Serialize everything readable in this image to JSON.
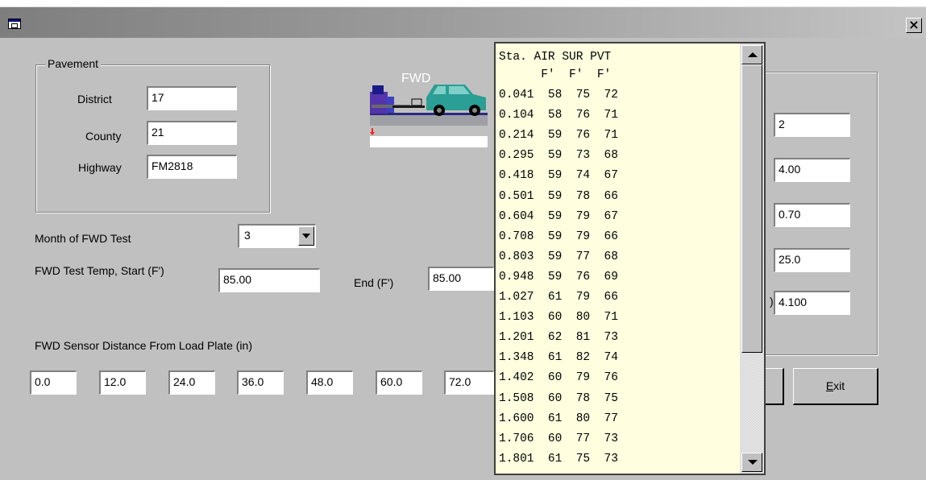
{
  "window": {
    "title": "",
    "close_label": "×"
  },
  "pavement": {
    "group_label": "Pavement",
    "district_label": "District",
    "district_value": "17",
    "county_label": "County",
    "county_value": "21",
    "highway_label": "Highway",
    "highway_value": "FM2818"
  },
  "logo": {
    "text": "FWD"
  },
  "month": {
    "label": "Month of FWD Test",
    "value": "3"
  },
  "temp": {
    "start_label": "FWD Test Temp, Start  (F')",
    "start_value": "85.00",
    "end_label": "End  (F')",
    "end_value": "85.00"
  },
  "sensors": {
    "label": "FWD Sensor Distance From Load Plate  (in)",
    "values": [
      "0.0",
      "12.0",
      "24.0",
      "36.0",
      "48.0",
      "60.0",
      "72.0"
    ]
  },
  "right_panel": {
    "values": [
      "2",
      "4.00",
      "0.70",
      "25.0",
      "4.100"
    ],
    "partial_label": ")"
  },
  "buttons": {
    "exit_prefix": "",
    "exit_mnemonic": "E",
    "exit_rest": "xit"
  },
  "list": {
    "header1": "Sta. AIR SUR PVT",
    "header2": "      F'  F'  F'",
    "rows": [
      "0.041  58  75  72",
      "0.104  58  76  71",
      "0.214  59  76  71",
      "0.295  59  73  68",
      "0.418  59  74  67",
      "0.501  59  78  66",
      "0.604  59  79  67",
      "0.708  59  79  66",
      "0.803  59  77  68",
      "0.948  59  76  69",
      "1.027  61  79  66",
      "1.103  60  80  71",
      "1.201  62  81  73",
      "1.348  61  82  74",
      "1.402  60  79  76",
      "1.508  60  78  75",
      "1.600  61  80  77",
      "1.706  60  77  73",
      "1.801  61  75  73"
    ]
  }
}
